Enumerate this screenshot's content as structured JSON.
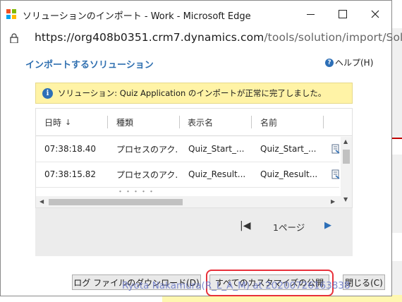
{
  "window": {
    "title": "ソリューションのインポート - Work - Microsoft Edge"
  },
  "address": {
    "url_host": "https://org408b0351.crm7.dynamics.com",
    "url_path": "/tools/solution/import/Sol..."
  },
  "page": {
    "heading": "インポートするソリューション",
    "help_label": "ヘルプ(H)"
  },
  "notice": {
    "text": "ソリューション: Quiz Application のインポートが正常に完了しました。"
  },
  "grid": {
    "columns": [
      "日時",
      "種類",
      "表示名",
      "名前"
    ],
    "sort_indicator": "↓",
    "rows": [
      {
        "time": "07:38:18.40",
        "type": "プロセスのアク...",
        "display": "Quiz_Start_...",
        "name": "Quiz_Start_..."
      },
      {
        "time": "07:38:15.82",
        "type": "プロセスのアク...",
        "display": "Quiz_Result...",
        "name": "Quiz_Result..."
      }
    ]
  },
  "pager": {
    "label": "1ページ"
  },
  "buttons": {
    "download_log": "ログ ファイルのダウンロード(D)",
    "publish_all": "すべてのカスタマイズの公開",
    "close": "閉じる(C)"
  },
  "watermark": "Ryota Nakamura(R_L_A_M) at 20200726163838",
  "colors": {
    "heading_blue": "#2f6fb0",
    "notice_bg": "#fff3a6",
    "highlight_red": "#e8303a",
    "pager_blue": "#2d6fb7"
  }
}
